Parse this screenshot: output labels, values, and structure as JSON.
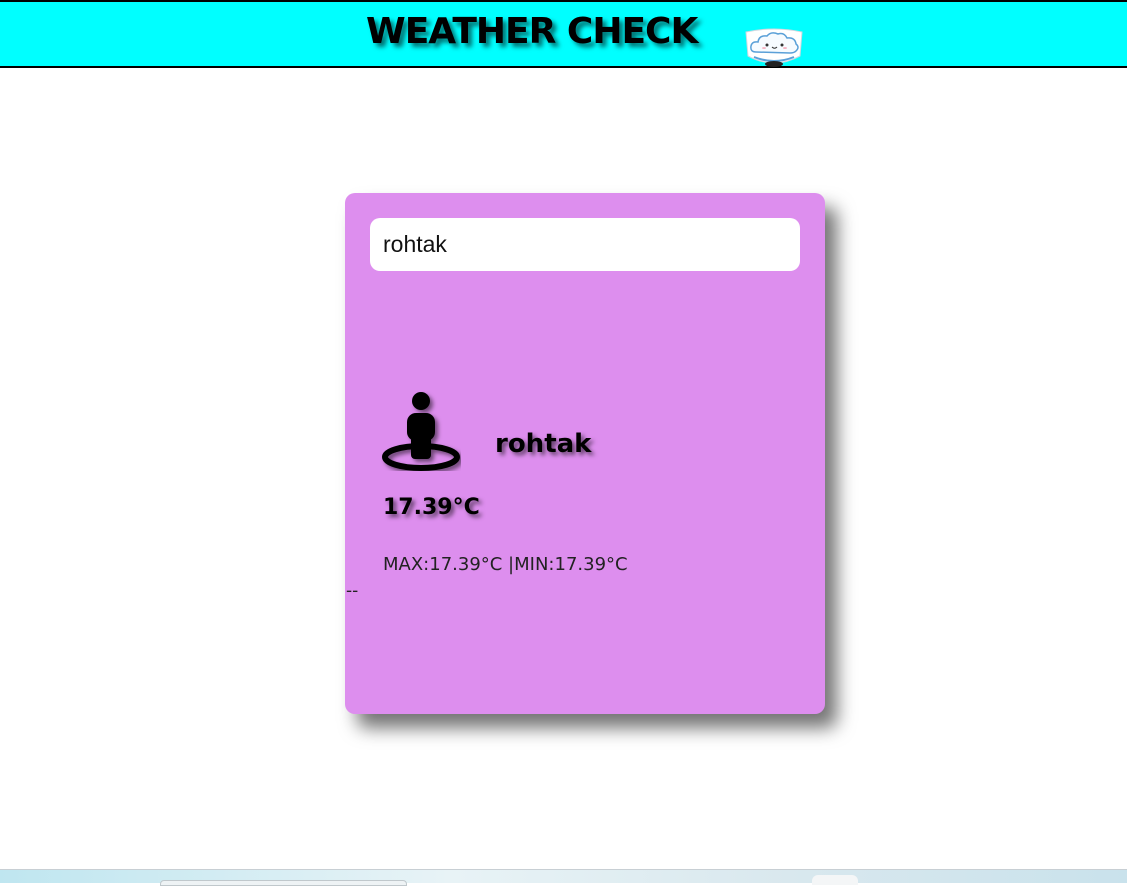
{
  "header": {
    "title": "WEATHER CHECK",
    "logo_icon": "cloud-logo-icon",
    "background_color": "#00ffff"
  },
  "card": {
    "background_color": "#dd8eee",
    "search": {
      "value": "rohtak",
      "placeholder": ""
    },
    "location_icon": "person-location-icon",
    "city": "rohtak",
    "temperature": "17.39°C",
    "minmax": "MAX:17.39°C |MIN:17.39°C",
    "extra_text": "--"
  }
}
